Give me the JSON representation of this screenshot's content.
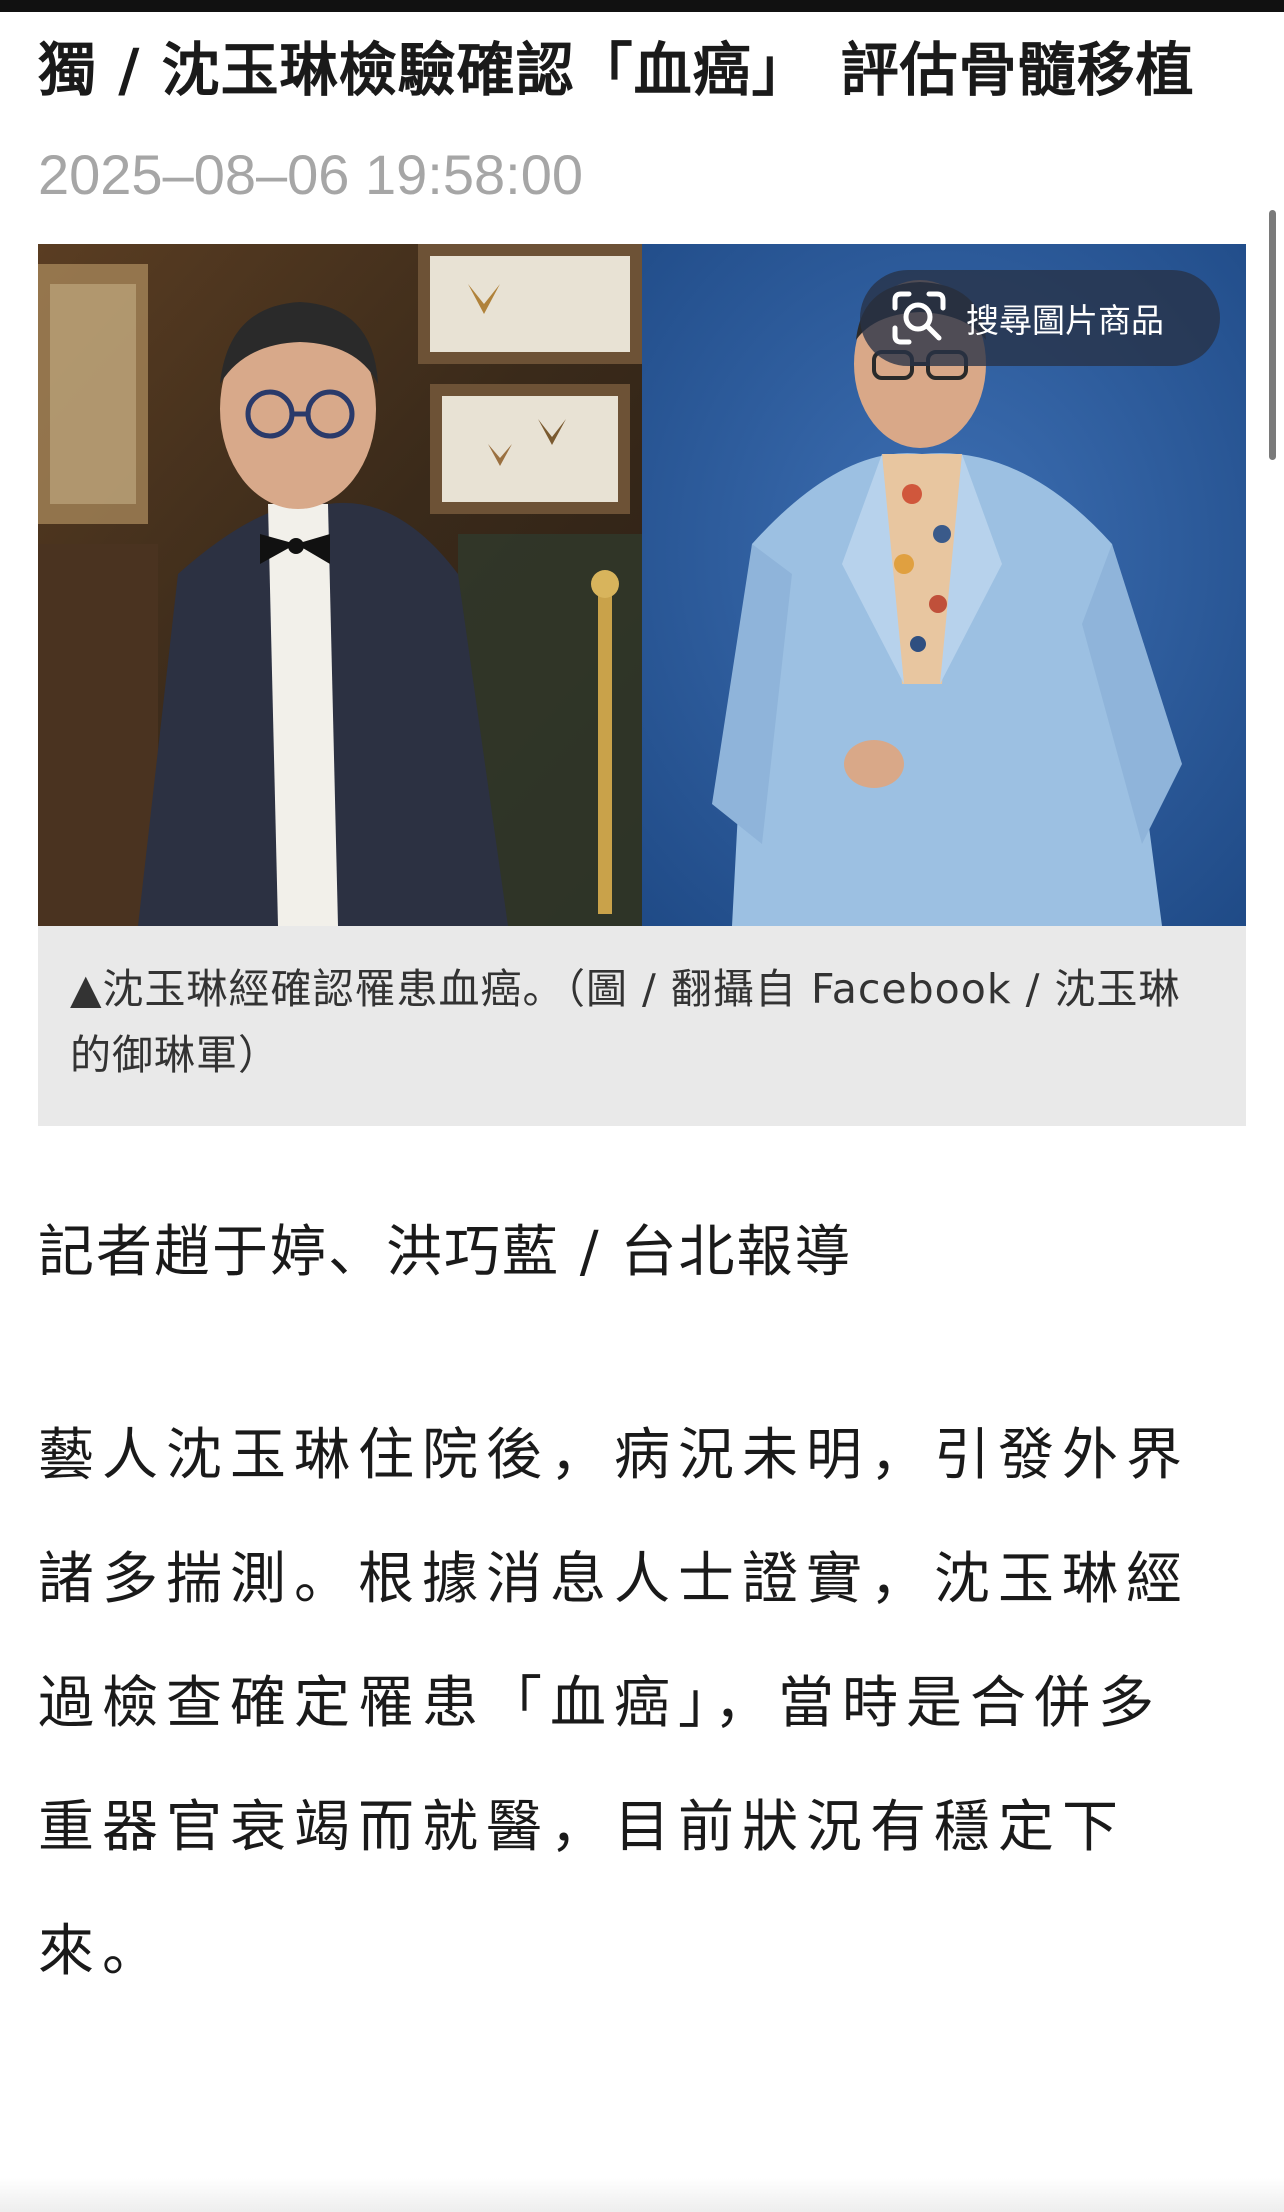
{
  "article": {
    "headline": "獨 / 沈玉琳檢驗確認「血癌」　評估骨髓移植",
    "timestamp": "2025–08–06 19:58:00",
    "figure": {
      "visual_search_label": "搜尋圖片商品",
      "visual_search_icon": "lens-search-icon",
      "caption": "▲沈玉琳經確認罹患血癌。（圖 / 翻攝自 Facebook / 沈玉琳的御琳軍）"
    },
    "byline": "記者趙于婷、洪巧藍 / 台北報導",
    "body_paragraph": "藝人沈玉琳住院後，病況未明，引發外界諸多揣測。根據消息人士證實，沈玉琳經過檢查確定罹患「血癌」，當時是合併多重器官衰竭而就醫，目前狀況有穩定下來。"
  },
  "colors": {
    "text": "#1a1a1a",
    "timestamp": "#a6a6a6",
    "caption_bg": "#e9e9e9",
    "photo_right_bg": "#2f5e9e",
    "pill_bg": "#283246"
  }
}
